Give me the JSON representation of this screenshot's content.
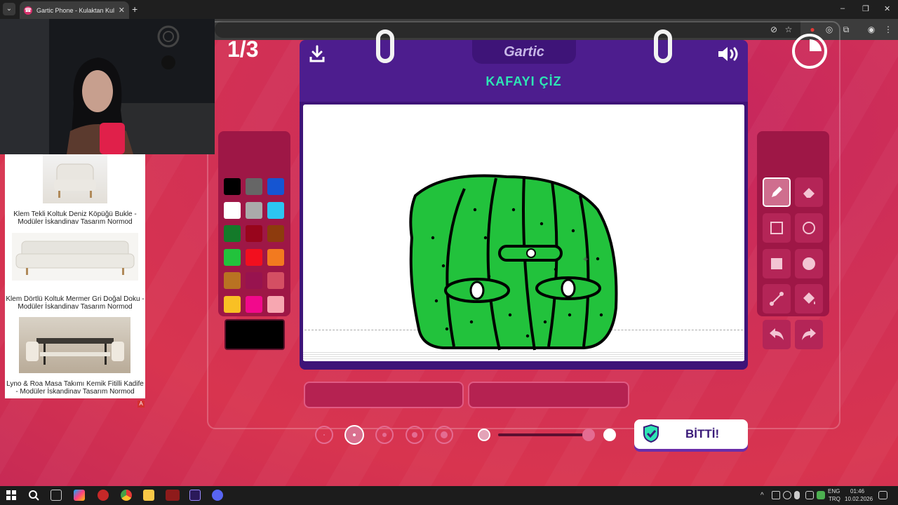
{
  "browser": {
    "tab_title": "Gartic Phone - Kulaktan Kulağa",
    "new_tab": "+",
    "tab_close": "✕",
    "window_min": "–",
    "window_restore": "❐",
    "window_close": "✕"
  },
  "game": {
    "round": "1/3",
    "logo": "Gartic",
    "prompt": "KAFAYI ÇİZ",
    "done_label": "BİTTİ!",
    "brush_opacity": 0.9,
    "selected_brush_size_index": 1,
    "selected_color": "#000000",
    "colors": [
      "#000000",
      "#666666",
      "#1555d2",
      "#ffffff",
      "#aaaaaa",
      "#2cc6f2",
      "#147a2a",
      "#98051c",
      "#8d3b0d",
      "#22c23c",
      "#f20f1e",
      "#f27a1f",
      "#b97222",
      "#98134f",
      "#d44f63",
      "#f9c024",
      "#f2098c",
      "#f7a7b1"
    ],
    "tools": [
      "pencil-icon",
      "eraser-icon",
      "rect-outline-icon",
      "circle-outline-icon",
      "rect-fill-icon",
      "circle-fill-icon",
      "line-icon",
      "bucket-icon",
      "undo-icon",
      "redo-icon"
    ]
  },
  "ads": [
    {
      "caption": "Klem Tekli Koltuk Deniz Köpüğü Bukle - Modüler İskandinav Tasarım Normod"
    },
    {
      "caption": "Klem Dörtlü Koltuk Mermer Gri Doğal Doku - Modüler İskandinav Tasarım Normod"
    },
    {
      "caption": "Lyno & Roa Masa Takımı Kemik Fitilli Kadife - Modüler İskandinav Tasarım Normod"
    }
  ],
  "ad_badge": "A",
  "taskbar": {
    "lang": "ENG",
    "layout": "TRQ",
    "time": "01:46",
    "date": "10.02.2026"
  }
}
